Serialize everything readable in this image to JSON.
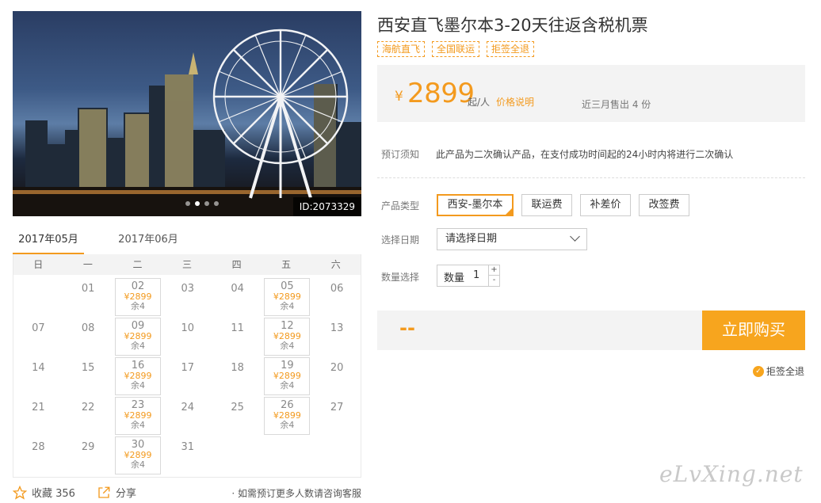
{
  "product": {
    "title": "西安直飞墨尔本3-20天往返含税机票",
    "tags": [
      "海航直飞",
      "全国联运",
      "拒签全退"
    ]
  },
  "hero": {
    "image_id": "ID:2073329",
    "slide_count": 4,
    "active_slide": 2
  },
  "price": {
    "currency": "¥",
    "amount": "2899",
    "unit": "起/人",
    "explain_link": "价格说明",
    "sold": "近三月售出 4 份"
  },
  "booking_notice": {
    "label": "预订须知",
    "text": "此产品为二次确认产品，在支付成功时间起的24小时内将进行二次确认"
  },
  "product_type": {
    "label": "产品类型",
    "options": [
      "西安-墨尔本",
      "联运费",
      "补差价",
      "改签费"
    ],
    "selected": 0
  },
  "date_select": {
    "label": "选择日期",
    "value": "请选择日期"
  },
  "quantity": {
    "label": "数量选择",
    "field_label": "数量",
    "value": "1",
    "plus": "+",
    "minus": "-"
  },
  "buy": {
    "total": "--",
    "button": "立即购买"
  },
  "refund_badge": "拒签全退",
  "calendar": {
    "months": [
      "2017年05月",
      "2017年06月"
    ],
    "active_month": 0,
    "weekdays": [
      "日",
      "一",
      "二",
      "三",
      "四",
      "五",
      "六"
    ],
    "start_offset": 1,
    "days": [
      "01",
      "02",
      "03",
      "04",
      "05",
      "06",
      "07",
      "08",
      "09",
      "10",
      "11",
      "12",
      "13",
      "14",
      "15",
      "16",
      "17",
      "18",
      "19",
      "20",
      "21",
      "22",
      "23",
      "24",
      "25",
      "26",
      "27",
      "28",
      "29",
      "30",
      "31"
    ],
    "priced_days": {
      "02": {
        "price": "¥2899",
        "remain": "余4"
      },
      "05": {
        "price": "¥2899",
        "remain": "余4"
      },
      "09": {
        "price": "¥2899",
        "remain": "余4"
      },
      "12": {
        "price": "¥2899",
        "remain": "余4"
      },
      "16": {
        "price": "¥2899",
        "remain": "余4"
      },
      "19": {
        "price": "¥2899",
        "remain": "余4"
      },
      "23": {
        "price": "¥2899",
        "remain": "余4"
      },
      "26": {
        "price": "¥2899",
        "remain": "余4"
      },
      "30": {
        "price": "¥2899",
        "remain": "余4"
      }
    }
  },
  "footer": {
    "favorite": "收藏 356",
    "share": "分享",
    "note": "· 如需预订更多人数请咨询客服"
  },
  "watermark": "eLvXing.net",
  "colors": {
    "accent": "#f39a1e",
    "button": "#f7a51e",
    "panel": "#f3f3f3"
  }
}
